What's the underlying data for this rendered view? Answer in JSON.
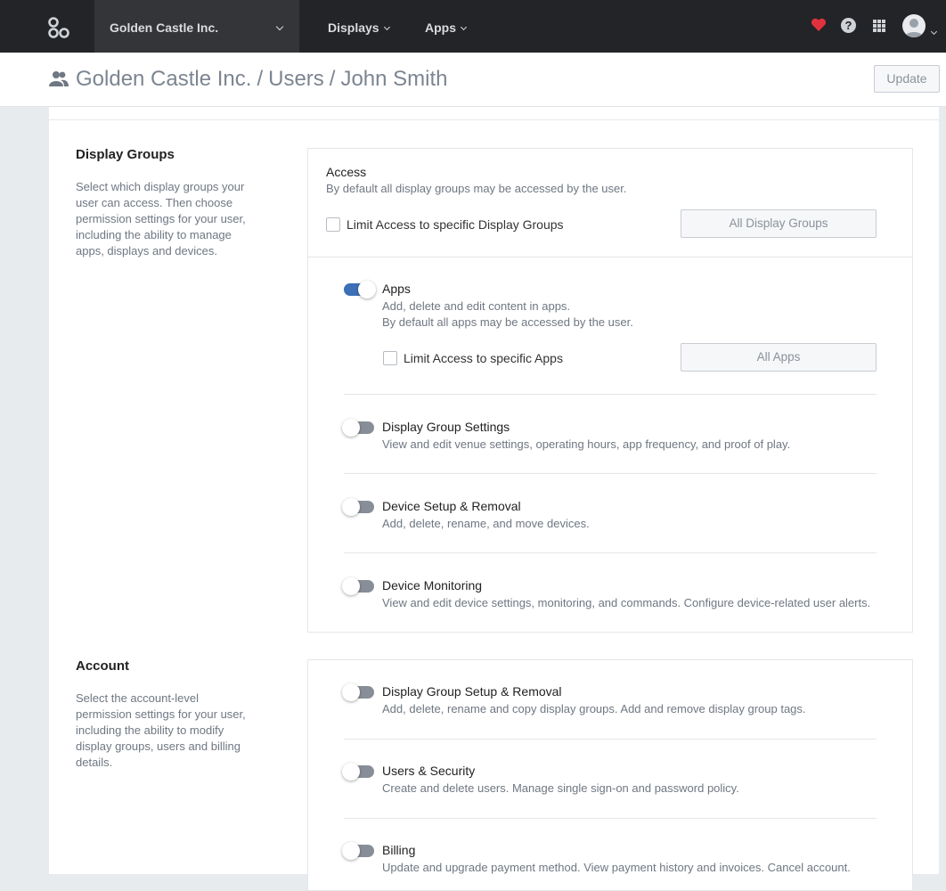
{
  "nav": {
    "org_name": "Golden Castle Inc.",
    "displays_label": "Displays",
    "apps_label": "Apps",
    "heart_color": "#e0323e",
    "icons": [
      "logo-icon",
      "heart-icon",
      "help-icon",
      "app-grid-icon",
      "avatar"
    ]
  },
  "header": {
    "breadcrumb": [
      "Golden Castle Inc.",
      "Users",
      "John Smith"
    ],
    "separator": "/",
    "update_label": "Update"
  },
  "display_groups": {
    "title": "Display Groups",
    "description": "Select which display groups your user can access. Then choose permission settings for your user, including the ability to manage apps, displays and devices.",
    "access_title": "Access",
    "access_desc": "By default all display groups may be accessed by the user.",
    "limit_label": "Limit Access to specific Display Groups",
    "limit_checked": false,
    "all_button": "All Display Groups",
    "permissions": [
      {
        "title": "Apps",
        "enabled": true,
        "desc": [
          "Add, delete and edit content in apps.",
          "By default all apps may be accessed by the user."
        ],
        "limit_label": "Limit Access to specific Apps",
        "limit_checked": false,
        "all_button": "All Apps"
      },
      {
        "title": "Display Group Settings",
        "enabled": false,
        "desc": [
          "View and edit venue settings, operating hours, app frequency, and proof of play."
        ]
      },
      {
        "title": "Device Setup & Removal",
        "enabled": false,
        "desc": [
          "Add, delete, rename, and move devices."
        ]
      },
      {
        "title": "Device Monitoring",
        "enabled": false,
        "desc": [
          "View and edit device settings, monitoring, and commands. Configure device-related user alerts."
        ]
      }
    ]
  },
  "account": {
    "title": "Account",
    "description": "Select the account-level permission settings for your user, including the ability to modify display groups, users and billing details.",
    "permissions": [
      {
        "title": "Display Group Setup & Removal",
        "enabled": false,
        "desc": [
          "Add, delete, rename and copy display groups. Add and remove display group tags."
        ]
      },
      {
        "title": "Users & Security",
        "enabled": false,
        "desc": [
          "Create and delete users. Manage single sign-on and password policy."
        ]
      },
      {
        "title": "Billing",
        "enabled": false,
        "desc": [
          "Update and upgrade payment method. View payment history and invoices. Cancel account."
        ]
      }
    ]
  },
  "colors": {
    "topbar": "#222427",
    "toggle_on": "#3c6fb5",
    "toggle_off": "#878e97"
  }
}
